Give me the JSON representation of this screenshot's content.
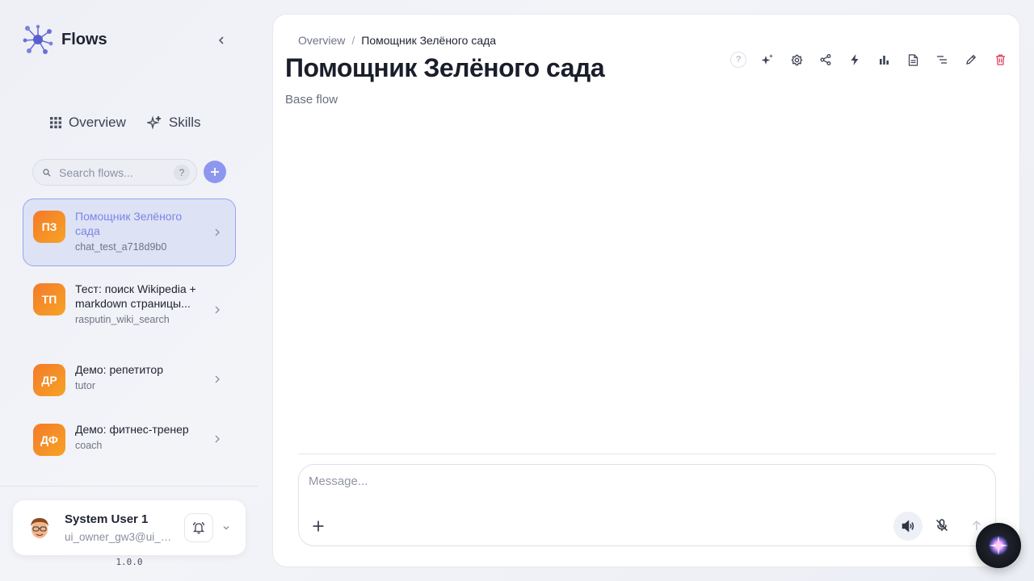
{
  "app": {
    "name": "Flows",
    "version": "1.0.0"
  },
  "nav": {
    "overview": "Overview",
    "skills": "Skills"
  },
  "search": {
    "placeholder": "Search flows...",
    "help": "?"
  },
  "flows": [
    {
      "initials": "ПЗ",
      "title": "Помощник Зелёного сада",
      "slug": "chat_test_a718d9b0",
      "active": true
    },
    {
      "initials": "ТП",
      "title": "Тест: поиск Wikipedia + markdown страницы...",
      "slug": "rasputin_wiki_search",
      "active": false
    },
    {
      "initials": "ДР",
      "title": "Демо: репетитор",
      "slug": "tutor",
      "active": false
    },
    {
      "initials": "ДФ",
      "title": "Демо: фитнес-тренер",
      "slug": "coach",
      "active": false
    }
  ],
  "user": {
    "name": "System User 1",
    "email": "ui_owner_gw3@ui_e..."
  },
  "breadcrumb": {
    "root": "Overview",
    "separator": "/",
    "current": "Помощник Зелёного сада"
  },
  "page": {
    "title": "Помощник Зелёного сада",
    "subtitle": "Base flow"
  },
  "toolbar": {
    "help": "?"
  },
  "composer": {
    "placeholder": "Message..."
  },
  "colors": {
    "accent": "#8e97f0",
    "avatar_from": "#f37a2a",
    "avatar_to": "#f7a325",
    "danger": "#e0405a"
  },
  "icons": {
    "toolbar": [
      "help-icon",
      "sparkles-icon",
      "gear-icon",
      "share-icon",
      "lightning-icon",
      "bar-chart-icon",
      "document-icon",
      "list-icon",
      "pencil-icon",
      "trash-icon"
    ]
  }
}
